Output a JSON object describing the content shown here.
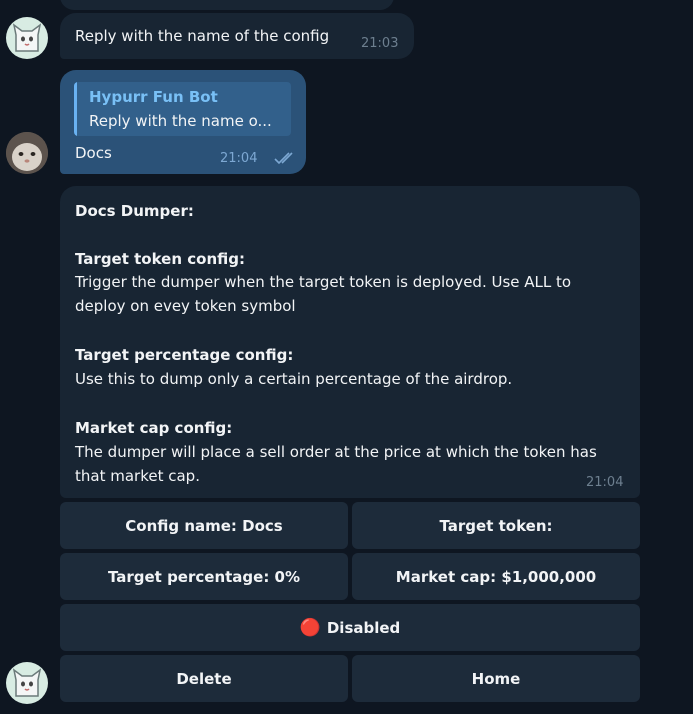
{
  "messages": {
    "bot_prompt": {
      "text": "Reply with the name of the config",
      "time": "21:03"
    },
    "user_reply": {
      "quote_author": "Hypurr Fun Bot",
      "quote_text": "Reply with the name o...",
      "text": "Docs",
      "time": "21:04"
    },
    "bot_info": {
      "title": "Docs Dumper:",
      "sections": [
        {
          "heading": "Target token config:",
          "body": "Trigger the dumper when the target token is deployed. Use ALL to deploy on evey token symbol"
        },
        {
          "heading": "Target percentage config:",
          "body": "Use this to dump only a certain percentage of the airdrop."
        },
        {
          "heading": "Market cap config:",
          "body": "The dumper will place a sell order at the price at which the token has that market cap."
        }
      ],
      "time": "21:04"
    }
  },
  "keyboard": {
    "config_name": "Config name: Docs",
    "target_token": "Target token:",
    "target_percentage": "Target percentage: 0%",
    "market_cap": "Market cap: $1,000,000",
    "status_icon": "🔴",
    "status_label": "Disabled",
    "delete": "Delete",
    "home": "Home"
  },
  "colors": {
    "background": "#0e1621",
    "incoming_bubble": "#182533",
    "outgoing_bubble": "#2b5278",
    "quote_accent": "#6ab2f2",
    "button": "#1d2b3a"
  },
  "icons": [
    "cat-avatar-icon",
    "user-photo-avatar-icon",
    "double-check-icon",
    "red-circle-icon"
  ]
}
